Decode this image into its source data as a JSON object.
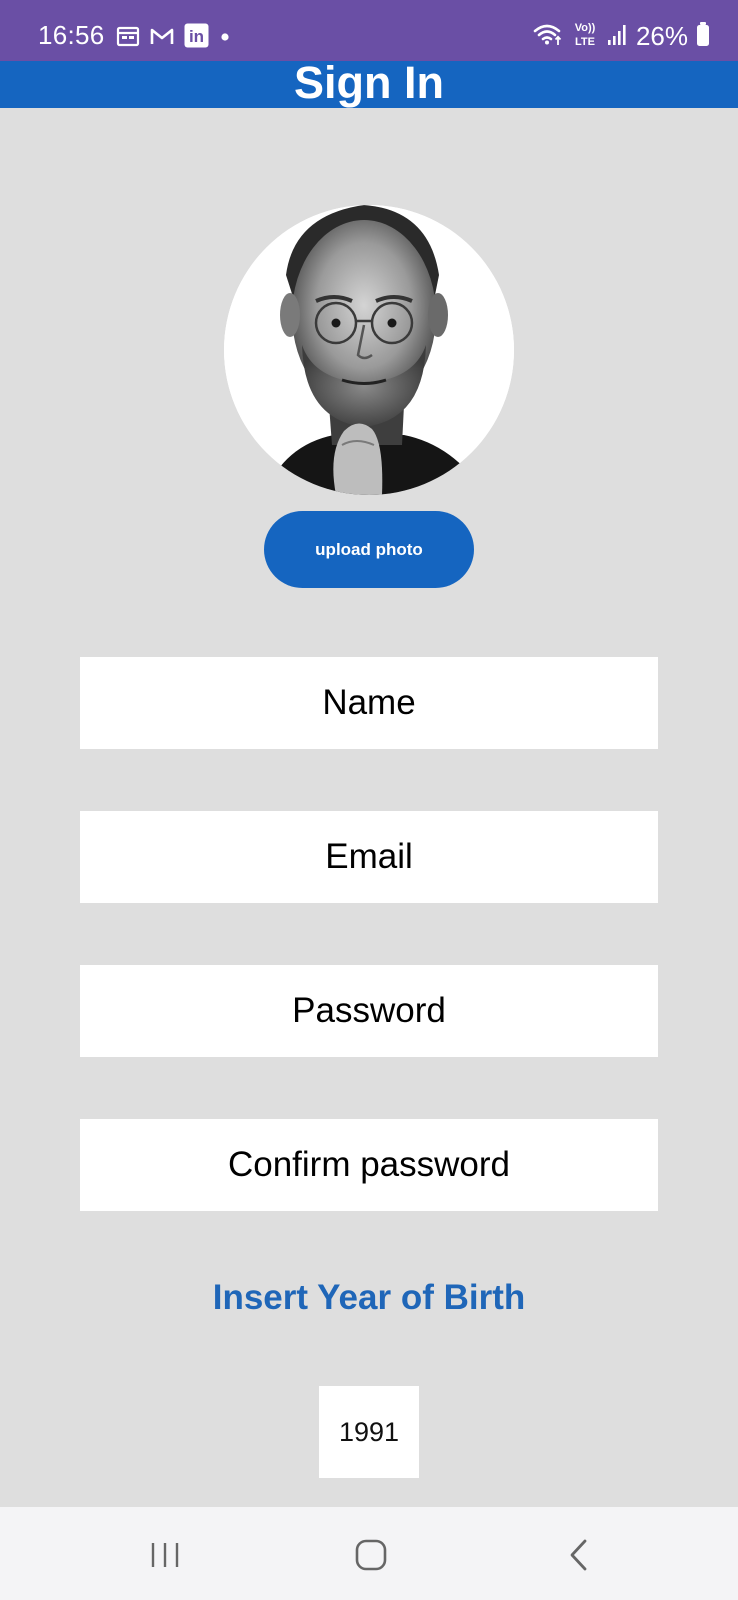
{
  "status_bar": {
    "time": "16:56",
    "left_icons": [
      "calendar-icon",
      "gmail-icon",
      "linkedin-icon",
      "notification-dot-icon"
    ],
    "right_icons": [
      "wifi-icon",
      "volte-icon",
      "signal-icon",
      "battery-icon"
    ],
    "volte_top": "Vo))",
    "volte_bottom": "LTE",
    "linkedin_text": "in",
    "battery": "26%",
    "color": "#6a4fa5"
  },
  "app_bar": {
    "title": "Sign In",
    "color": "#1565c0"
  },
  "profile": {
    "avatar_description": "profile-photo",
    "upload_label": "upload photo"
  },
  "form": {
    "name_placeholder": "Name",
    "email_placeholder": "Email",
    "password_placeholder": "Password",
    "confirm_password_placeholder": "Confirm password"
  },
  "birth_year": {
    "label": "Insert Year of Birth",
    "value": "1991",
    "label_color": "#1f66b8"
  },
  "nav_bar": {
    "buttons": [
      "recent-apps-icon",
      "home-icon",
      "back-icon"
    ]
  }
}
